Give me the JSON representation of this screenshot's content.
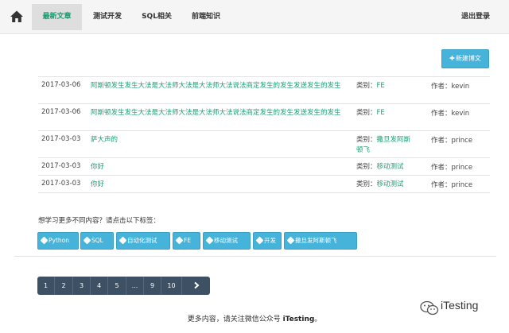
{
  "nav": {
    "items": [
      {
        "label": "最新文章",
        "active": true
      },
      {
        "label": "测试开发",
        "active": false
      },
      {
        "label": "SQL相关",
        "active": false
      },
      {
        "label": "前端知识",
        "active": false
      }
    ],
    "logout_label": "退出登录",
    "accent_color": "#1a9e6f"
  },
  "new_post_label": "新建博文",
  "articles": [
    {
      "date": "2017-03-06",
      "title": "阿斯顿发生发生大法是大法师大法是大法师大法说法商定发生的发生发送发生的发生",
      "category_label": "类别：",
      "category": "FE",
      "author_label": "作者：",
      "author": "kevin"
    },
    {
      "date": "2017-03-06",
      "title": "阿斯顿发生发生大法是大法师大法是大法师大法说法商定发生的发生发送发生的发生",
      "category_label": "类别：",
      "category": "FE",
      "author_label": "作者：",
      "author": "kevin"
    },
    {
      "date": "2017-03-03",
      "title": "萨大声的",
      "category_label": "类别：",
      "category": "撒旦发阿斯顿飞",
      "author_label": "作者：",
      "author": "prince"
    },
    {
      "date": "2017-03-03",
      "title": "你好",
      "category_label": "类别：",
      "category": "移动测试",
      "author_label": "作者：",
      "author": "prince"
    },
    {
      "date": "2017-03-03",
      "title": "你好",
      "category_label": "类别：",
      "category": "移动测试",
      "author_label": "作者：",
      "author": "prince"
    }
  ],
  "tags_title": "想学习更多不同内容？请点击以下标签：",
  "tags": [
    "Python",
    "SQL",
    "自动化测试",
    "FE",
    "移动测试",
    "开发",
    "撒旦发阿斯顿飞"
  ],
  "pager": [
    "1",
    "2",
    "3",
    "4",
    "5",
    "...",
    "9",
    "10"
  ],
  "watermark": "iTesting",
  "footer": {
    "prefix": "更多内容，请关注微信公众号 ",
    "account": "iTesting",
    "suffix": "。"
  },
  "colors": {
    "button": "#46b3da",
    "pager_bg": "#3e5064"
  }
}
